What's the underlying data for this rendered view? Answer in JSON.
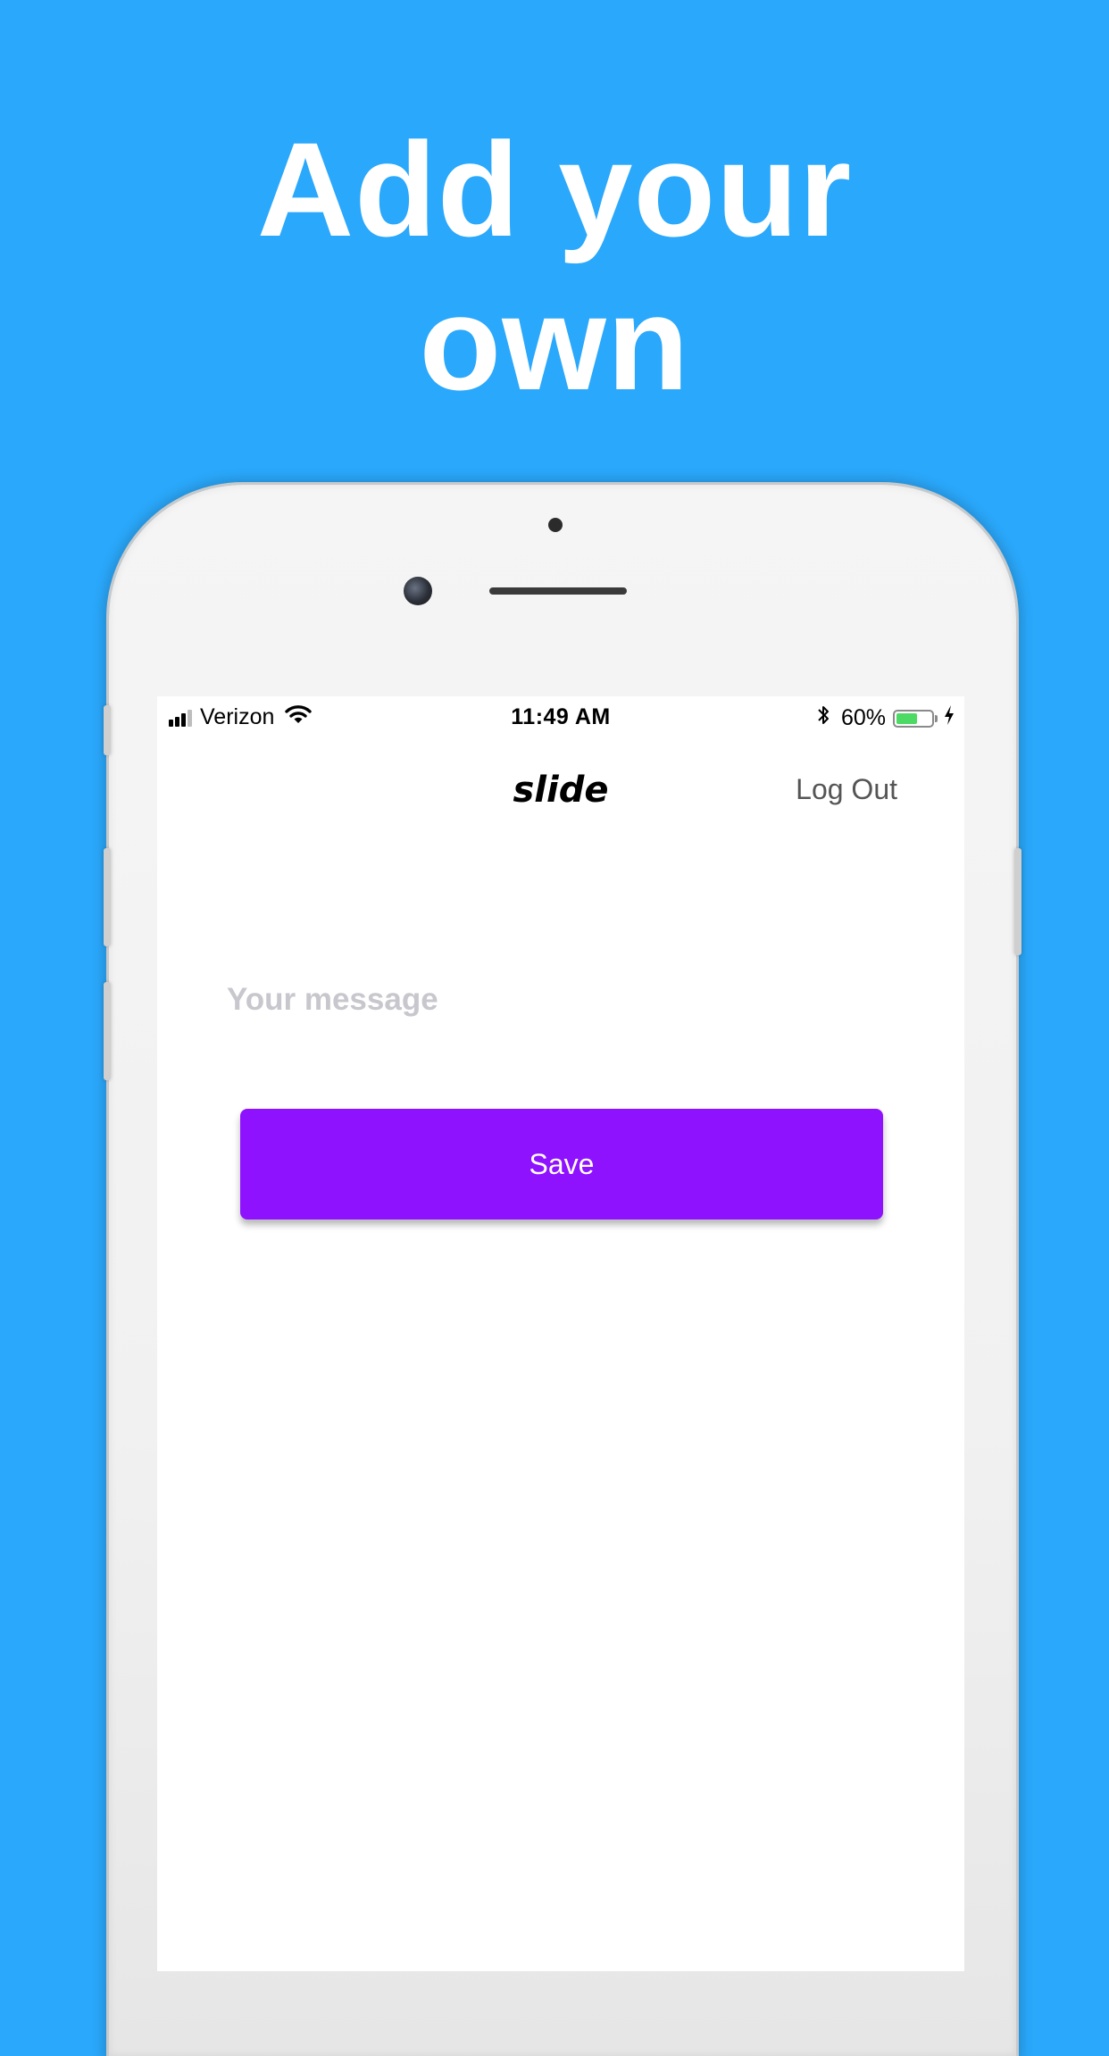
{
  "headline": {
    "line1": "Add your",
    "line2": "own"
  },
  "status_bar": {
    "carrier": "Verizon",
    "time": "11:49 AM",
    "battery_percent_text": "60%",
    "battery_level": 0.6,
    "signal_bars": 3,
    "signal_bars_total": 4,
    "icons": [
      "signal-icon",
      "wifi-icon",
      "bluetooth-icon",
      "battery-icon",
      "charging-icon"
    ]
  },
  "nav": {
    "title": "slide",
    "logout_label": "Log Out"
  },
  "form": {
    "message_placeholder": "Your message",
    "message_value": "",
    "save_label": "Save"
  },
  "colors": {
    "background": "#2aa8fb",
    "accent": "#8f12fe",
    "battery_fill": "#4cd964",
    "placeholder": "#c7c7cd"
  }
}
